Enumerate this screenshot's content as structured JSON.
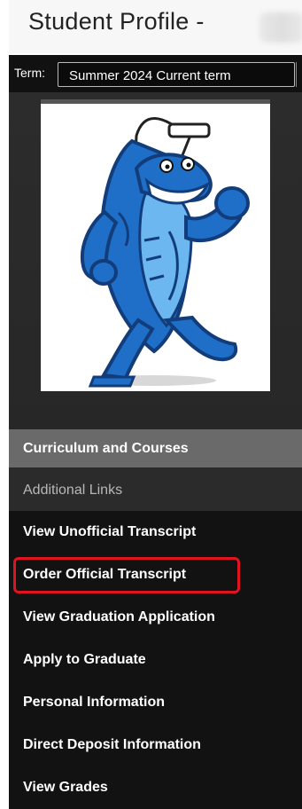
{
  "header": {
    "title": "Student Profile -"
  },
  "term": {
    "label": "Term:",
    "selected": "Summer 2024 Current term"
  },
  "profile_image": {
    "description": "shark-mascot"
  },
  "sections": {
    "primary": "Curriculum and Courses",
    "secondary": "Additional Links"
  },
  "links": [
    "View Unofficial Transcript",
    "Order Official Transcript",
    "View Graduation Application",
    "Apply to Graduate",
    "Personal Information",
    "Direct Deposit Information",
    "View Grades"
  ],
  "colors": {
    "sidebar_bg": "#121212",
    "section_primary": "#6a6a6a",
    "highlight": "#e0141e",
    "mascot_blue": "#1f6fc8"
  }
}
